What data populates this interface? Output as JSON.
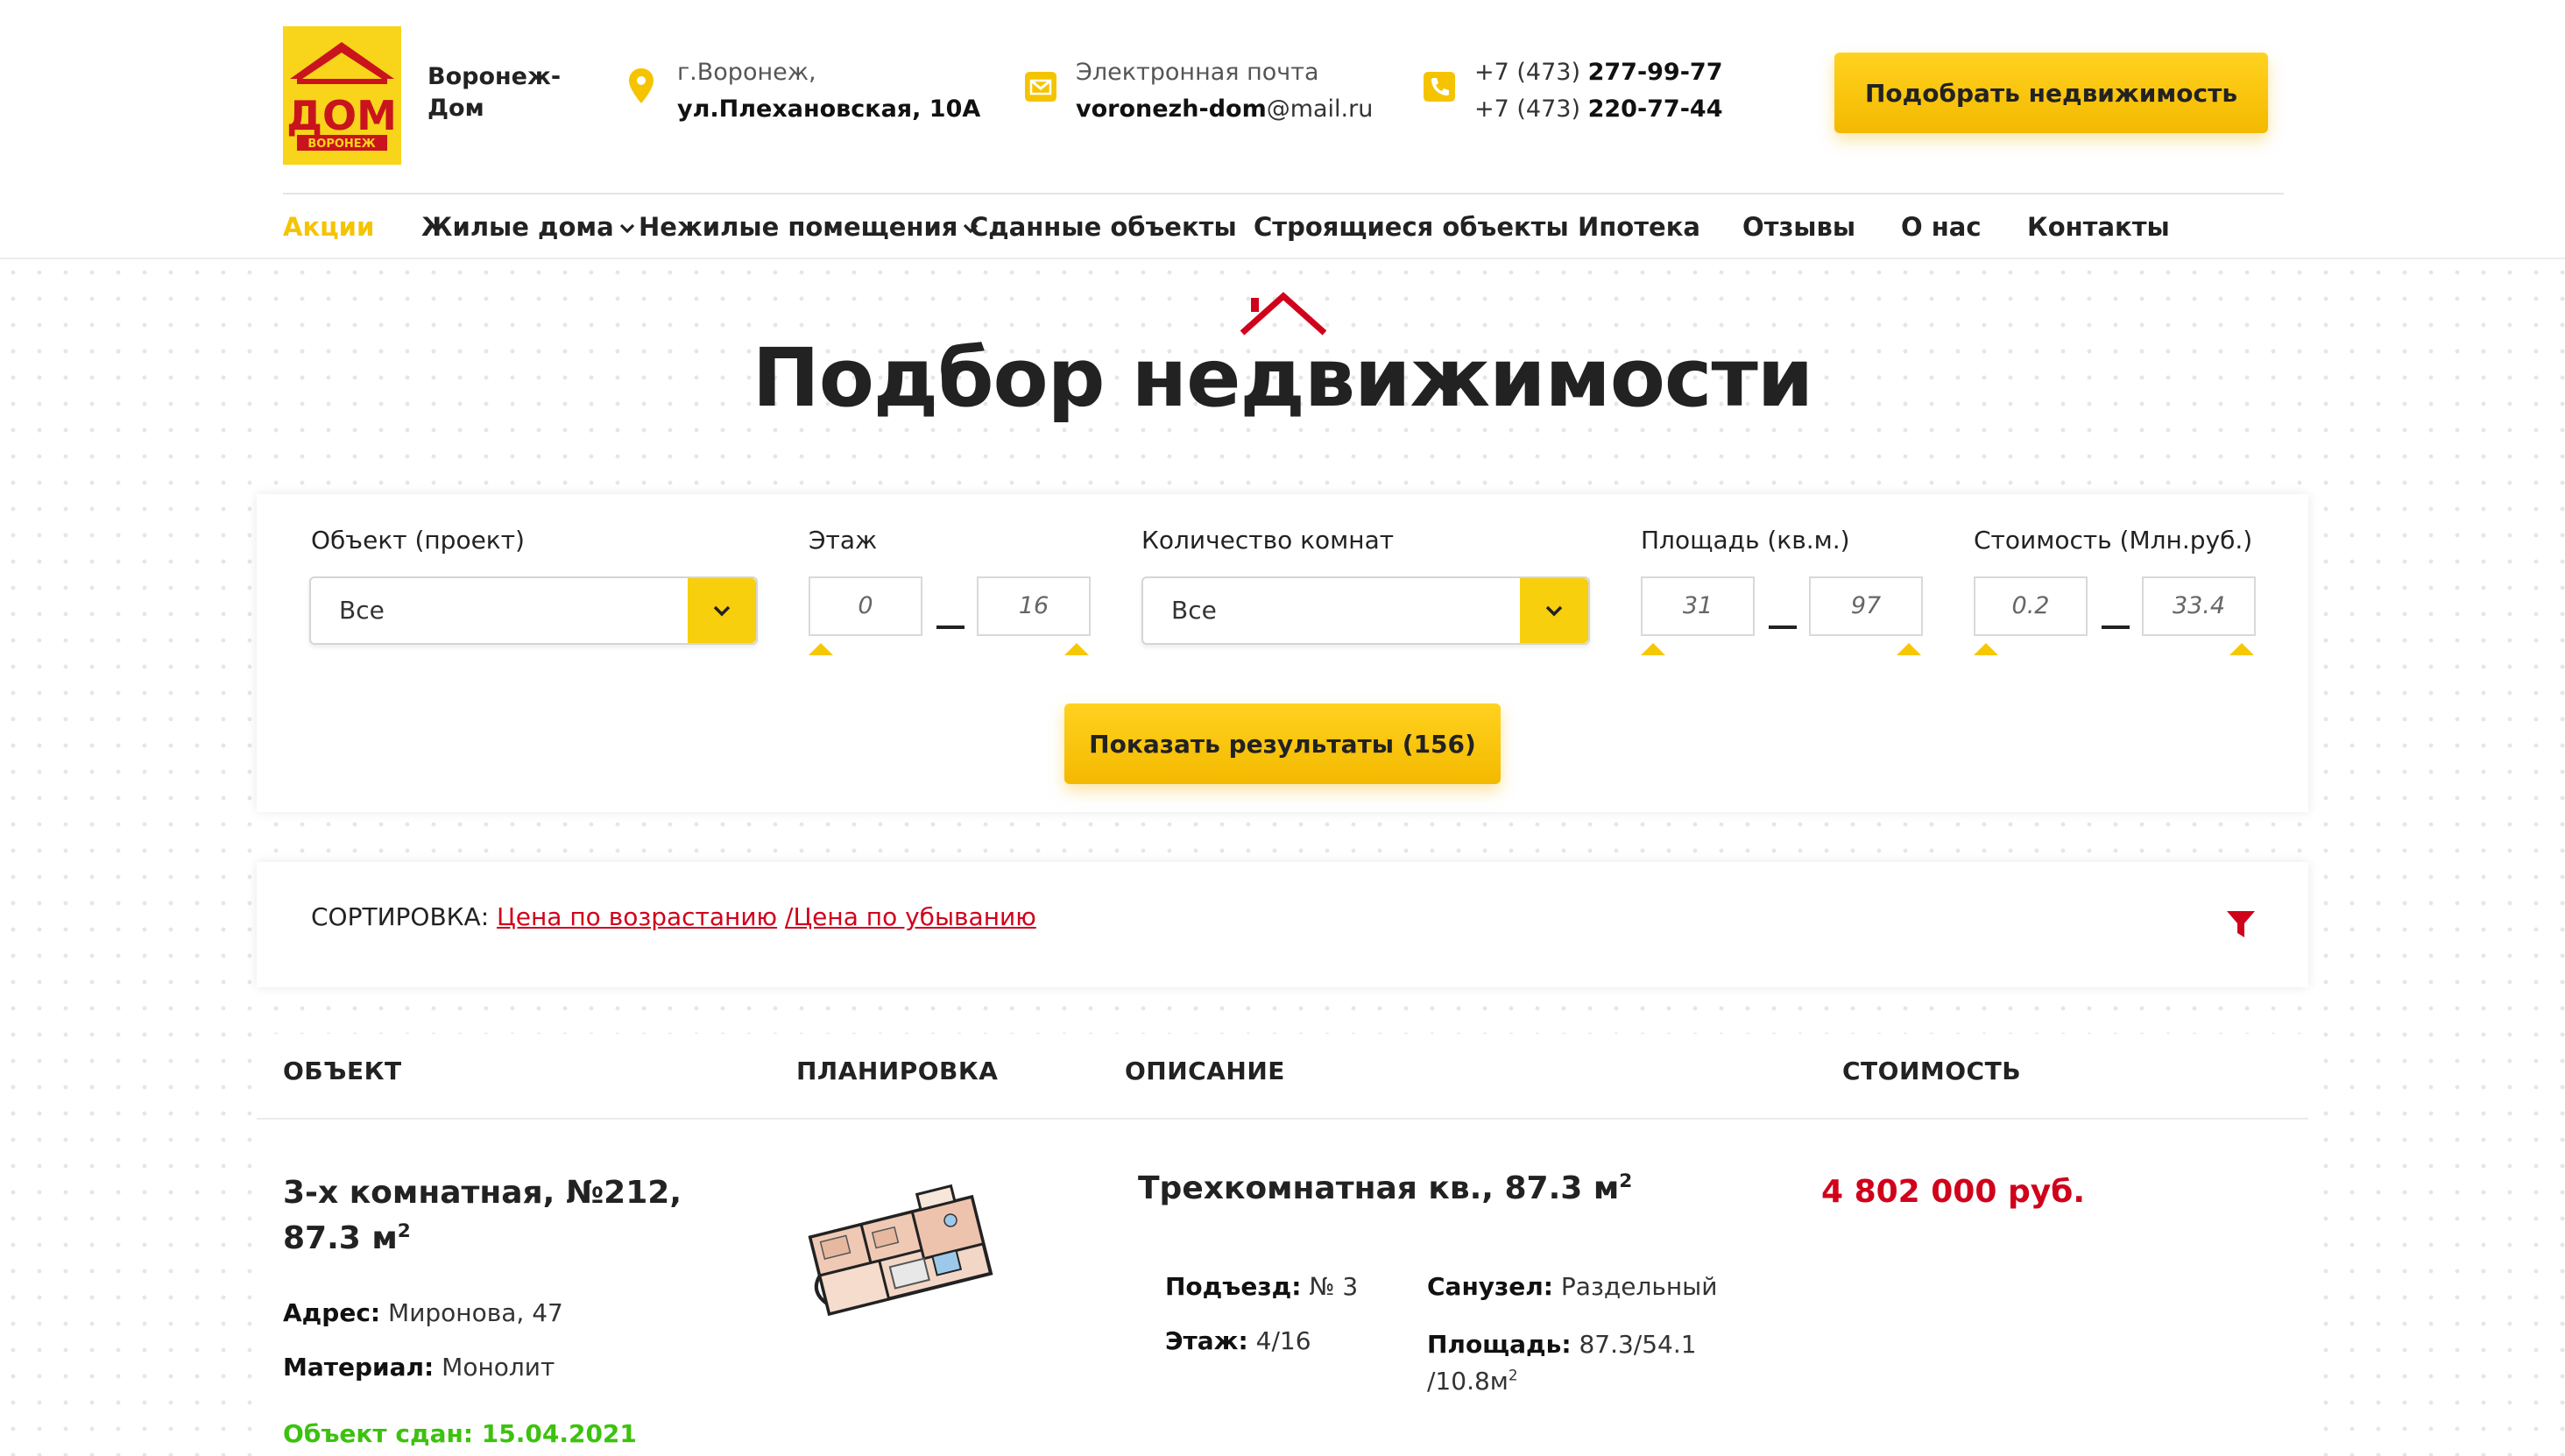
{
  "brand": {
    "logo_text": "ДОМ",
    "logo_sub": "ВОРОНЕЖ",
    "name_line1": "Воронеж-",
    "name_line2": "Дом"
  },
  "contacts": {
    "address_city": "г.Воронеж,",
    "address_street": "ул.Плехановская, 10А",
    "email_label": "Электронная почта",
    "email_user": "voronezh-dom",
    "email_domain": "@mail.ru",
    "phone1_prefix": "+7 (473) ",
    "phone1_number": "277-99-77",
    "phone2_prefix": "+7 (473) ",
    "phone2_number": "220-77-44"
  },
  "header_cta": "Подобрать недвижимость",
  "nav": {
    "items": [
      {
        "label": "Акции"
      },
      {
        "label": "Жилые дома"
      },
      {
        "label": "Нежилые помещения"
      },
      {
        "label": "Сданные объекты"
      },
      {
        "label": "Строящиеся объекты"
      },
      {
        "label": "Ипотека"
      },
      {
        "label": "Отзывы"
      },
      {
        "label": "О нас"
      },
      {
        "label": "Контакты"
      }
    ]
  },
  "page_title": "Подбор недвижимости",
  "filters": {
    "object_label": "Объект (проект)",
    "object_value": "Все",
    "floor_label": "Этаж",
    "floor_min": "0",
    "floor_max": "16",
    "rooms_label": "Количество комнат",
    "rooms_value": "Все",
    "area_label": "Площадь (кв.м.)",
    "area_min": "31",
    "area_max": "97",
    "price_label": "Стоимость (Млн.руб.)",
    "price_min": "0.2",
    "price_max": "33.4",
    "show_button": "Показать результаты (156)"
  },
  "sort": {
    "label": "СОРТИРОВКА:",
    "asc": "Цена по возрастанию",
    "separator": "/",
    "desc": "Цена по убыванию"
  },
  "table": {
    "headers": [
      "ОБЪЕКТ",
      "ПЛАНИРОВКА",
      "ОПИСАНИЕ",
      "СТОИМОСТЬ"
    ],
    "rows": [
      {
        "title": "3-х комнатная, №212, 87.3 м",
        "title_sup": "2",
        "address_label": "Адрес:",
        "address": "Миронова, 47",
        "material_label": "Материал:",
        "material": "Монолит",
        "status": "Объект сдан: 15.04.2021",
        "desc_title": "Трехкомнатная кв., 87.3 м",
        "desc_sup": "2",
        "entrance_label": "Подъезд:",
        "entrance": "№ 3",
        "floor_label": "Этаж:",
        "floor": "4/16",
        "bath_label": "Санузел:",
        "bath": "Раздельный",
        "area_label": "Площадь:",
        "area_line1": "87.3/54.1",
        "area_line2": "/10.8м",
        "area_sup": "2",
        "price": "4 802 000 руб."
      }
    ]
  }
}
